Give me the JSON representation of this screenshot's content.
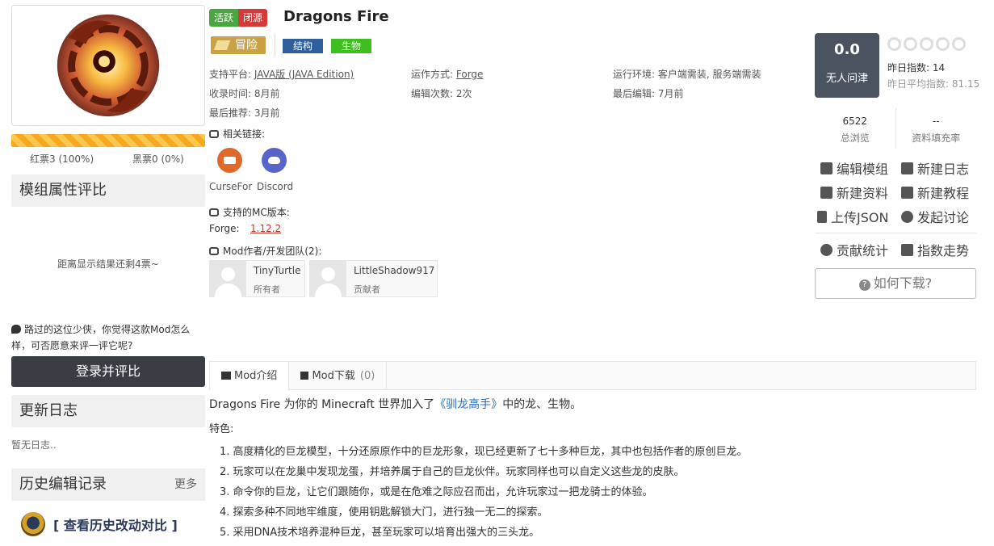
{
  "mod": {
    "status_tags": [
      "活跃",
      "闭源"
    ],
    "title": "Dragons Fire",
    "main_category": "冒险",
    "categories": [
      "结构",
      "生物"
    ]
  },
  "votes": {
    "red": "红票3 (100%)",
    "black": "黑票0 (0%)",
    "progress_red_fraction": 1.0
  },
  "left": {
    "attr_heading": "模组属性评比",
    "remain_note": "距离显示结果还剩4票~",
    "ask_note": "路过的这位少侠，你觉得这款Mod怎么样，可否愿意来评一评它呢?",
    "login_button": "登录并评比",
    "changelog_heading": "更新日志",
    "changelog_empty": "暂无日志..",
    "history_heading": "历史编辑记录",
    "history_more": "更多",
    "history_compare": "[ 查看历史改动对比 ]"
  },
  "info": {
    "platform_label": "支持平台:",
    "platform_value": "JAVA版 (JAVA Edition)",
    "runtime_label": "运作方式:",
    "runtime_value": "Forge",
    "env_label": "运行环境:",
    "env_value": "客户端需装, 服务端需装",
    "collected_label": "收录时间:",
    "collected_value": "8月前",
    "edits_label": "编辑次数:",
    "edits_value": "2次",
    "lastedit_label": "最后编辑:",
    "lastedit_value": "7月前",
    "recommend_label": "最后推荐:",
    "recommend_value": "3月前"
  },
  "links": {
    "heading": "相关链接:",
    "items": [
      {
        "label": "CurseFor",
        "icon": "curseforge-icon"
      },
      {
        "label": "Discord",
        "icon": "discord-icon"
      }
    ]
  },
  "versions": {
    "heading": "支持的MC版本:",
    "loader": "Forge:",
    "list": [
      "1.12.2"
    ]
  },
  "authors": {
    "heading": "Mod作者/开发团队(2):",
    "items": [
      {
        "name": "TinyTurtle",
        "role": "所有者"
      },
      {
        "name": "LittleShadow917",
        "role": "贡献者"
      }
    ]
  },
  "score": {
    "value": "0.0",
    "label": "无人问津",
    "yesterday_index": "昨日指数: 14",
    "yesterday_avg": "昨日平均指数: 81.15",
    "views_value": "6522",
    "views_label": "总浏览",
    "fill_value": "--",
    "fill_label": "资料填充率"
  },
  "actions": {
    "edit_mod": "编辑模组",
    "new_log": "新建日志",
    "new_info": "新建资料",
    "new_tutorial": "新建教程",
    "upload_json": "上传JSON",
    "discuss": "发起讨论",
    "contrib_stats": "贡献统计",
    "index_trend": "指数走势",
    "how_download": "如何下载?"
  },
  "tabs": [
    {
      "label": "Mod介绍",
      "count": ""
    },
    {
      "label": "Mod下载",
      "count": "(0)"
    }
  ],
  "content": {
    "intro_pre": "Dragons Fire 为你的 Minecraft 世界加入了",
    "intro_link": "《驯龙高手》",
    "intro_post": "中的龙、生物。",
    "features_label": "特色:",
    "features": [
      "1. 高度精化的巨龙模型，十分还原原作中的巨龙形象，现已经更新了七十多种巨龙，其中也包括作者的原创巨龙。",
      "2. 玩家可以在龙巢中发现龙蛋，并培养属于自己的巨龙伙伴。玩家同样也可以自定义这些龙的皮肤。",
      "3. 命令你的巨龙，让它们跟随你，或是在危难之际应召而出，允许玩家过一把龙骑士的体验。",
      "4. 探索多种不同地牢维度，使用钥匙解锁大门，进行独一无二的探索。",
      "5. 采用DNA技术培养混种巨龙，甚至玩家可以培育出强大的三头龙。"
    ]
  }
}
